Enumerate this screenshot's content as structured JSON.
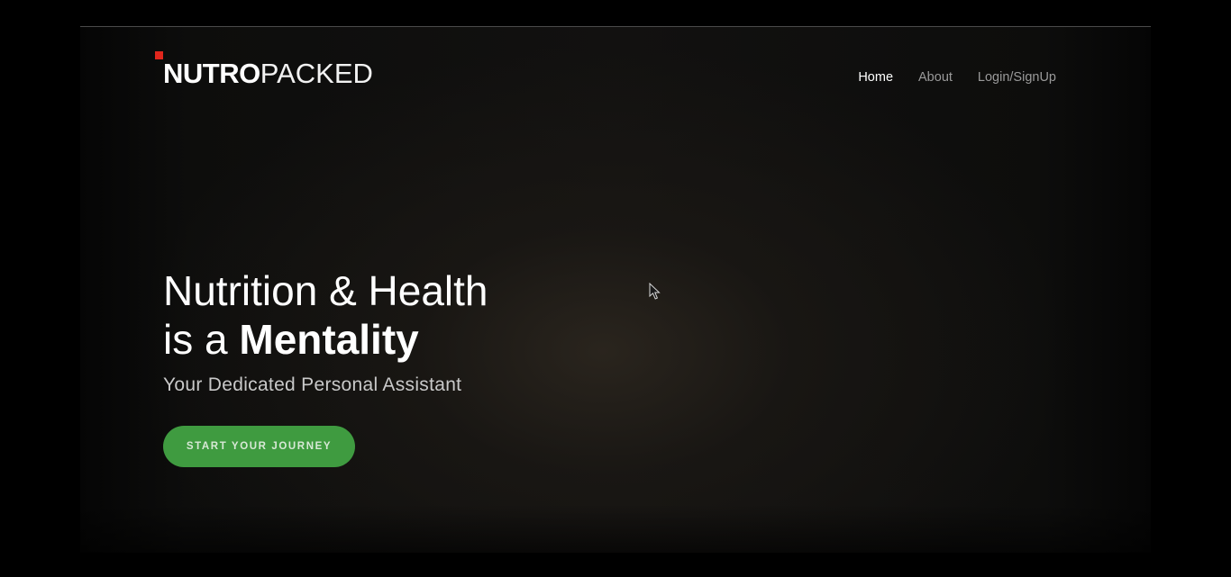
{
  "brand": {
    "logo_bold": "NUTRO",
    "logo_light": "PACKED",
    "accent_color": "#e0261c"
  },
  "nav": {
    "items": [
      {
        "label": "Home",
        "active": true
      },
      {
        "label": "About",
        "active": false
      },
      {
        "label": "Login/SignUp",
        "active": false
      }
    ]
  },
  "hero": {
    "headline_line1": "Nutrition & Health",
    "headline_line2_prefix": "is a ",
    "headline_line2_strong": "Mentality",
    "subtitle": "Your Dedicated Personal Assistant",
    "cta_label": "START YOUR JOURNEY",
    "cta_color": "#3f9b40"
  },
  "icons": {
    "pointer": "mouse-pointer-icon"
  }
}
